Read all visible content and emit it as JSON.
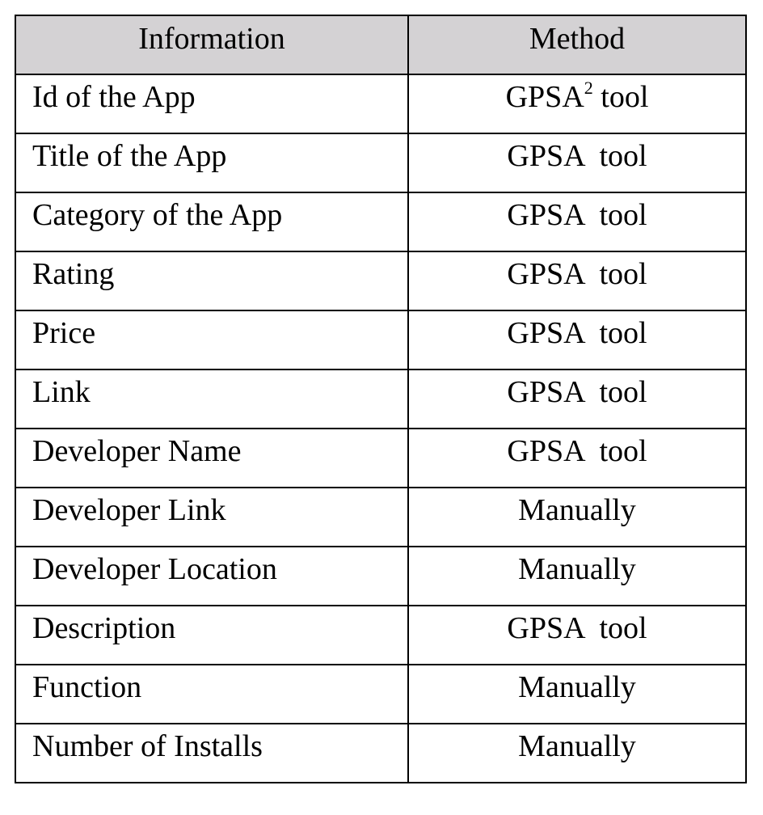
{
  "table": {
    "headers": [
      "Information",
      "Method"
    ],
    "header_bg": "#d4d2d4",
    "footnote_marker": "2",
    "rows": [
      {
        "information": "Id of the App",
        "method": "GPSA",
        "method_suffix": " tool",
        "has_footnote": true
      },
      {
        "information": "Title of the App",
        "method": "GPSA  tool"
      },
      {
        "information": "Category of the App",
        "method": "GPSA  tool"
      },
      {
        "information": "Rating",
        "method": "GPSA  tool"
      },
      {
        "information": "Price",
        "method": "GPSA  tool"
      },
      {
        "information": "Link",
        "method": "GPSA  tool"
      },
      {
        "information": "Developer Name",
        "method": "GPSA  tool"
      },
      {
        "information": "Developer Link",
        "method": "Manually"
      },
      {
        "information": "Developer Location",
        "method": "Manually"
      },
      {
        "information": "Description",
        "method": "GPSA  tool"
      },
      {
        "information": "Function",
        "method": "Manually"
      },
      {
        "information": "Number of Installs",
        "method": "Manually"
      }
    ]
  }
}
